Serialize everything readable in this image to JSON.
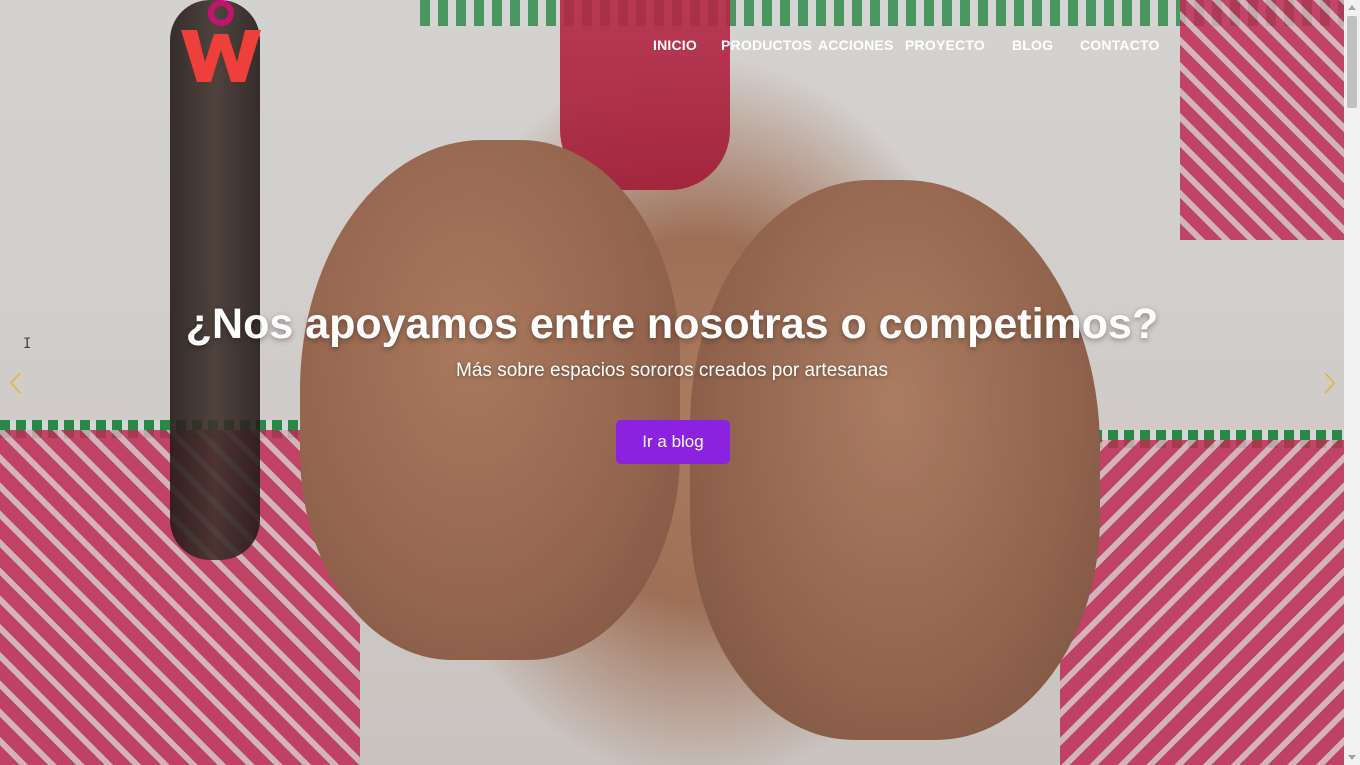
{
  "nav": {
    "items": [
      {
        "label": "INICIO"
      },
      {
        "label": "PRODUCTOS"
      },
      {
        "label": "ACCIONES"
      },
      {
        "label": "PROYECTO"
      },
      {
        "label": "BLOG"
      },
      {
        "label": "CONTACTO"
      }
    ]
  },
  "logo": {
    "icon": "ow-logo",
    "letters": "OW",
    "colors": {
      "o": "#c4136f",
      "w": "#ee3f3a"
    }
  },
  "hero": {
    "headline": "¿Nos apoyamos entre nosotras o competimos?",
    "subline": "Más sobre espacios sororos creados por artesanas",
    "cta_label": "Ir a blog",
    "cta_color": "#8a22e0",
    "prev_icon": "chevron-left-icon",
    "next_icon": "chevron-right-icon",
    "arrow_color": "#e3b43c"
  }
}
